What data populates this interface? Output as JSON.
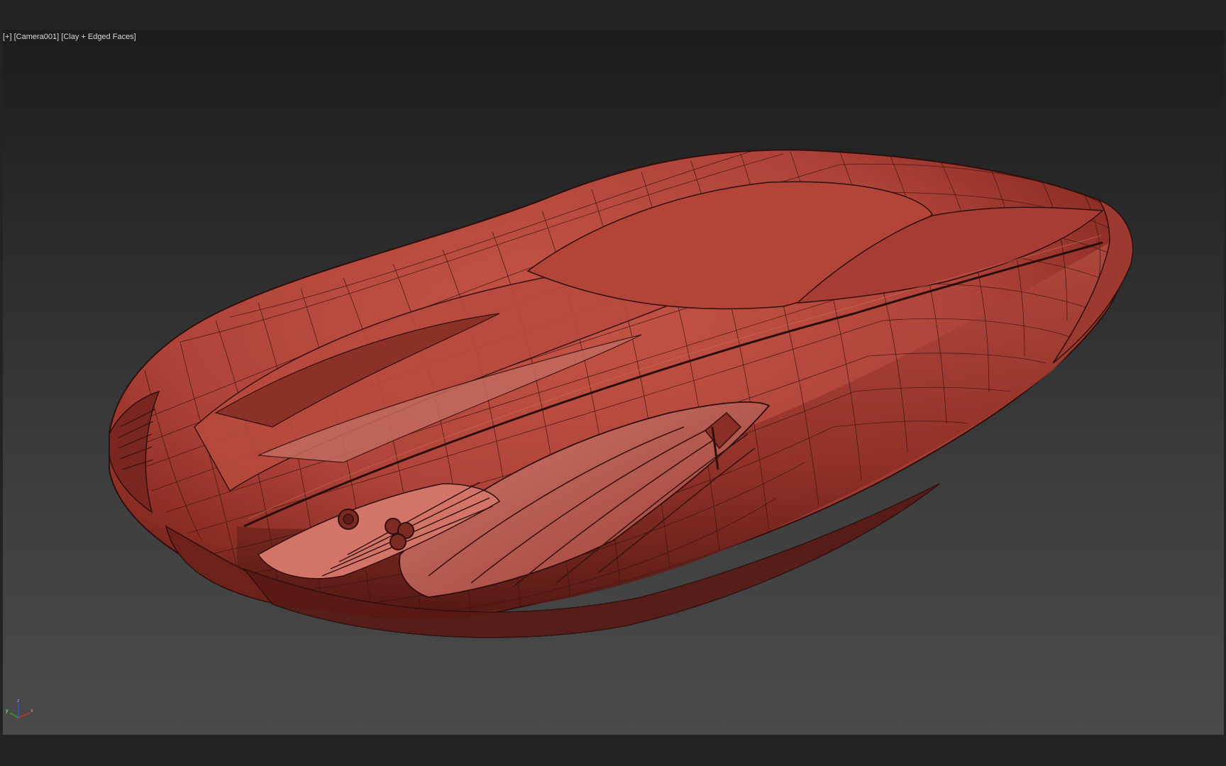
{
  "viewport": {
    "label_menu": "[+]",
    "label_camera": "[Camera001]",
    "label_shading": "[Clay + Edged Faces]"
  },
  "gizmo": {
    "axis_z": "z",
    "axis_x": "x",
    "axis_y": "y"
  },
  "colors": {
    "clay": "#b8483d",
    "clay_dark": "#6a1f1a",
    "edge": "#3a1410",
    "axis_x": "#d03030",
    "axis_y": "#30a030",
    "axis_z": "#3050d0"
  }
}
